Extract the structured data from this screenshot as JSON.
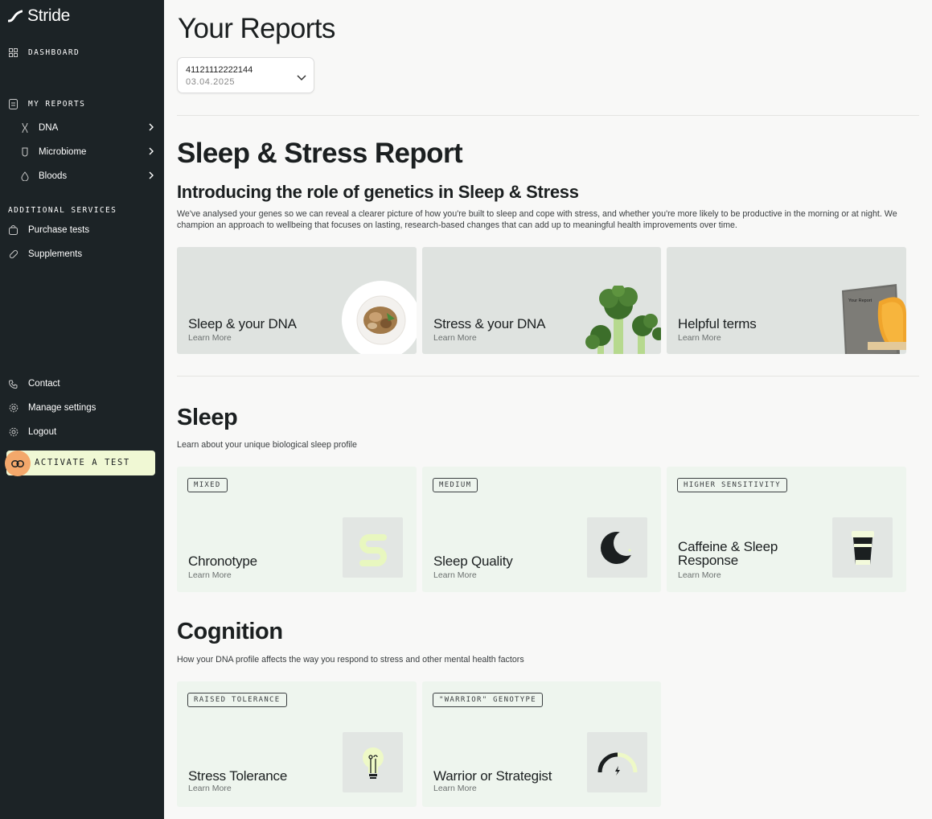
{
  "sidebar": {
    "brand": "Stride",
    "dashboard": "DASHBOARD",
    "my_reports": "MY REPORTS",
    "report_items": [
      {
        "label": "DNA",
        "icon": "dna-icon"
      },
      {
        "label": "Microbiome",
        "icon": "microbiome-icon"
      },
      {
        "label": "Bloods",
        "icon": "drop-icon"
      }
    ],
    "additional_services": "ADDITIONAL SERVICES",
    "service_items": [
      {
        "label": "Purchase tests",
        "icon": "bag-icon"
      },
      {
        "label": "Supplements",
        "icon": "pill-icon"
      }
    ],
    "bottom_items": [
      {
        "label": "Contact",
        "icon": "phone-icon"
      },
      {
        "label": "Manage settings",
        "icon": "gear-icon"
      },
      {
        "label": "Logout",
        "icon": "logout-icon"
      }
    ],
    "activate_label": "ACTIVATE A TEST"
  },
  "main": {
    "title": "Your Reports",
    "report_select": {
      "id": "41121112222144",
      "date": "03.04.2025"
    },
    "report_title": "Sleep & Stress Report",
    "intro_heading": "Introducing the role of genetics in Sleep & Stress",
    "intro_text": "We've analysed your genes so we can reveal a clearer picture of how you're built to sleep and cope with stress, and whether you're more likely to be productive in the morning or at night. We champion an approach to wellbeing that focuses on lasting, research-based changes that can add up to meaningful health improvements over time.",
    "info_cards": [
      {
        "title": "Sleep & your DNA",
        "more": "Learn More"
      },
      {
        "title": "Stress & your DNA",
        "more": "Learn More"
      },
      {
        "title": "Helpful terms",
        "more": "Learn More",
        "book_text": "Your Report"
      }
    ],
    "sleep": {
      "heading": "Sleep",
      "subtitle": "Learn about your unique biological sleep profile",
      "cards": [
        {
          "badge": "MIXED",
          "title": "Chronotype",
          "more": "Learn More",
          "icon": "chronotype-icon"
        },
        {
          "badge": "MEDIUM",
          "title": "Sleep Quality",
          "more": "Learn More",
          "icon": "moon-icon"
        },
        {
          "badge": "HIGHER SENSITIVITY",
          "title_line1": "Caffeine & Sleep",
          "title_line2": "Response",
          "more": "Learn More",
          "icon": "coffee-cup-icon"
        }
      ]
    },
    "cognition": {
      "heading": "Cognition",
      "subtitle": "How your DNA profile affects the way you respond to stress and other mental health factors",
      "cards": [
        {
          "badge": "RAISED TOLERANCE",
          "title": "Stress Tolerance",
          "more": "Learn More",
          "icon": "lightbulb-icon"
        },
        {
          "badge": "\"WARRIOR\" GENOTYPE",
          "title": "Warrior or Strategist",
          "more": "Learn More",
          "icon": "gauge-icon"
        }
      ]
    }
  },
  "colors": {
    "sidebar_bg": "#1c2326",
    "accent_orange": "#f4a86b",
    "accent_lime": "#f0f8d4",
    "card_green": "#eef5ee",
    "card_grey": "#dfe3e0"
  }
}
